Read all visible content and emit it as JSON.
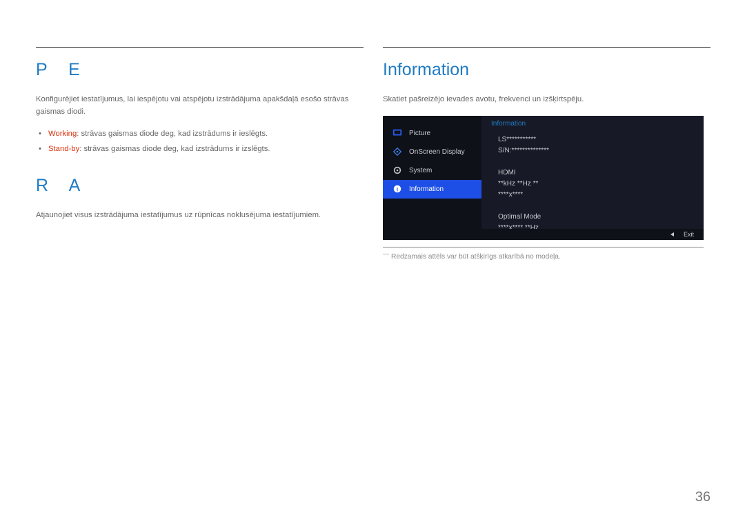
{
  "left": {
    "heading1": "P E",
    "body1": "Konfigurējiet iestatījumus, lai iespējotu vai atspējotu izstrādājuma apakšdaļā esošo strāvas gaismas diodi.",
    "bullets": [
      {
        "label": "Working",
        "text": ": strāvas gaismas diode deg, kad izstrādums ir ieslēgts."
      },
      {
        "label": "Stand-by",
        "text": ": strāvas gaismas diode deg, kad izstrādums ir izslēgts."
      }
    ],
    "heading2": "R A",
    "body2": "Atjaunojiet visus izstrādājuma iestatījumus uz rūpnīcas noklusējuma iestatījumiem."
  },
  "right": {
    "heading": "Information",
    "body": "Skatiet pašreizējo ievades avotu, frekvenci un izšķirtspēju.",
    "osd": {
      "items": [
        {
          "label": "Picture",
          "selected": false
        },
        {
          "label": "OnScreen Display",
          "selected": false
        },
        {
          "label": "System",
          "selected": false
        },
        {
          "label": "Information",
          "selected": true
        }
      ],
      "panel_title": "Information",
      "lines": [
        "LS***********",
        "S/N:**************",
        "",
        "HDMI",
        "**kHz **Hz **",
        "****x****",
        "",
        "Optimal Mode",
        "****x**** **Hz"
      ],
      "exit": "Exit"
    },
    "footnote": "Redzamais attēls var būt atšķirīgs atkarībā no modeļa."
  },
  "page_number": "36"
}
